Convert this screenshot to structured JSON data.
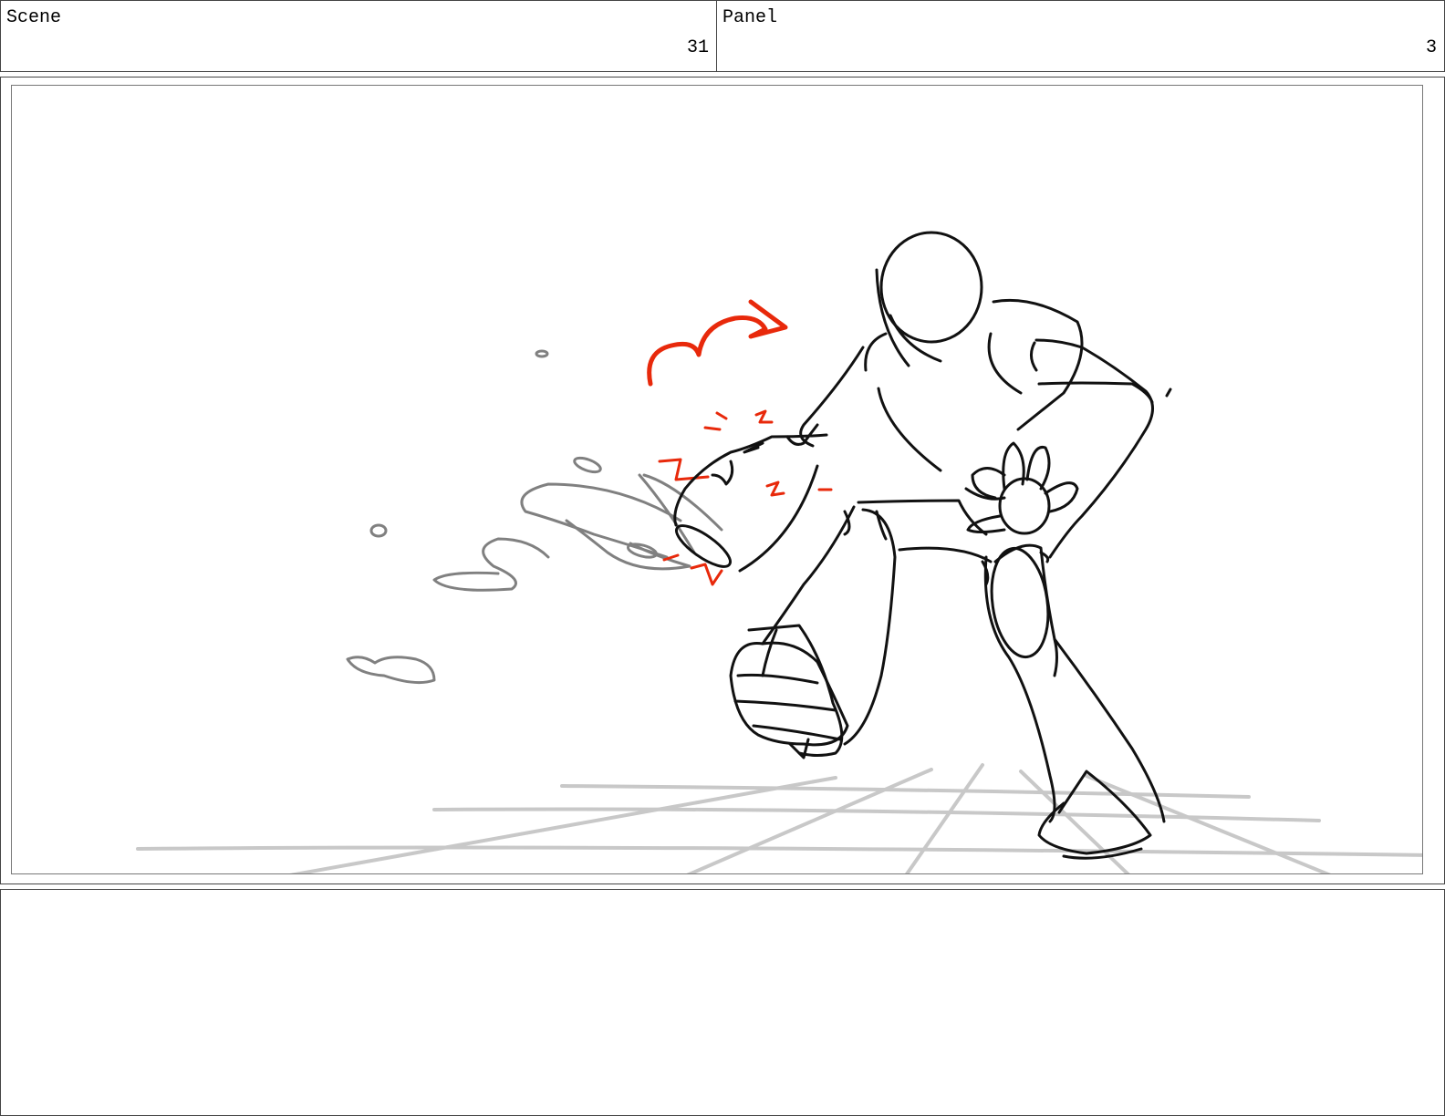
{
  "header": {
    "scene_label": "Scene",
    "scene_number": "31",
    "panel_label": "Panel",
    "panel_number": "3"
  },
  "notes": {
    "text": ""
  },
  "colors": {
    "line": "#111111",
    "effect_gray": "#808080",
    "floor_gray": "#c8c8c8",
    "action_red": "#e8290b"
  }
}
